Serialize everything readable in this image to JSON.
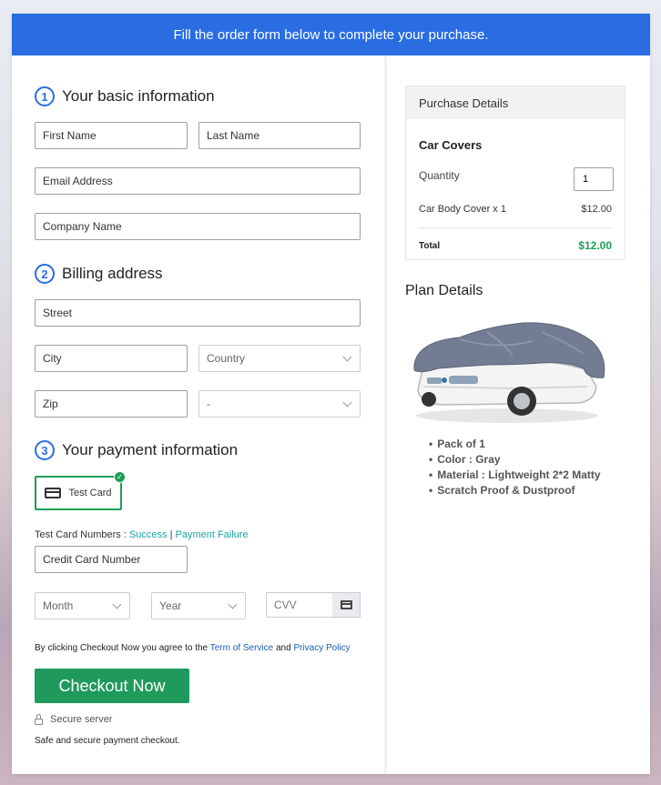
{
  "banner": {
    "text": "Fill the order form below to complete your purchase."
  },
  "steps": [
    {
      "num": "1",
      "title": "Your basic information"
    },
    {
      "num": "2",
      "title": "Billing address"
    },
    {
      "num": "3",
      "title": "Your payment information"
    }
  ],
  "basic": {
    "first_name": "First Name",
    "last_name": "Last Name",
    "email": "Email Address",
    "company": "Company Name"
  },
  "billing": {
    "street": "Street",
    "city": "City",
    "country": "Country",
    "zip": "Zip",
    "state": "-"
  },
  "payment": {
    "test_card_label": "Test Card",
    "test_numbers_label": "Test Card Numbers :",
    "success_link": "Success",
    "separator": "|",
    "failure_link": "Payment Failure",
    "card_number": "Credit Card Number",
    "month": "Month",
    "year": "Year",
    "cvv": "CVV"
  },
  "agreement": {
    "prefix": "By clicking Checkout Now you agree to the",
    "terms": "Term of Service",
    "and": "and",
    "privacy": "Privacy Policy"
  },
  "checkout_label": "Checkout Now",
  "secure_label": "Secure server",
  "safe_label": "Safe and secure payment checkout.",
  "purchase": {
    "header": "Purchase Details",
    "product": "Car Covers",
    "quantity_label": "Quantity",
    "quantity_value": "1",
    "line_item": "Car Body Cover x 1",
    "line_price": "$12.00",
    "total_label": "Total",
    "total_value": "$12.00"
  },
  "plan": {
    "title": "Plan Details",
    "features": [
      "Pack of 1",
      "Color : Gray",
      "Material : Lightweight 2*2 Matty",
      "Scratch Proof & Dustproof"
    ]
  },
  "colors": {
    "banner": "#2a6de2",
    "checkout": "#1f9a5c",
    "total": "#1e9e55",
    "link": "#1e5fb3",
    "test_link": "#1aa3a3"
  }
}
